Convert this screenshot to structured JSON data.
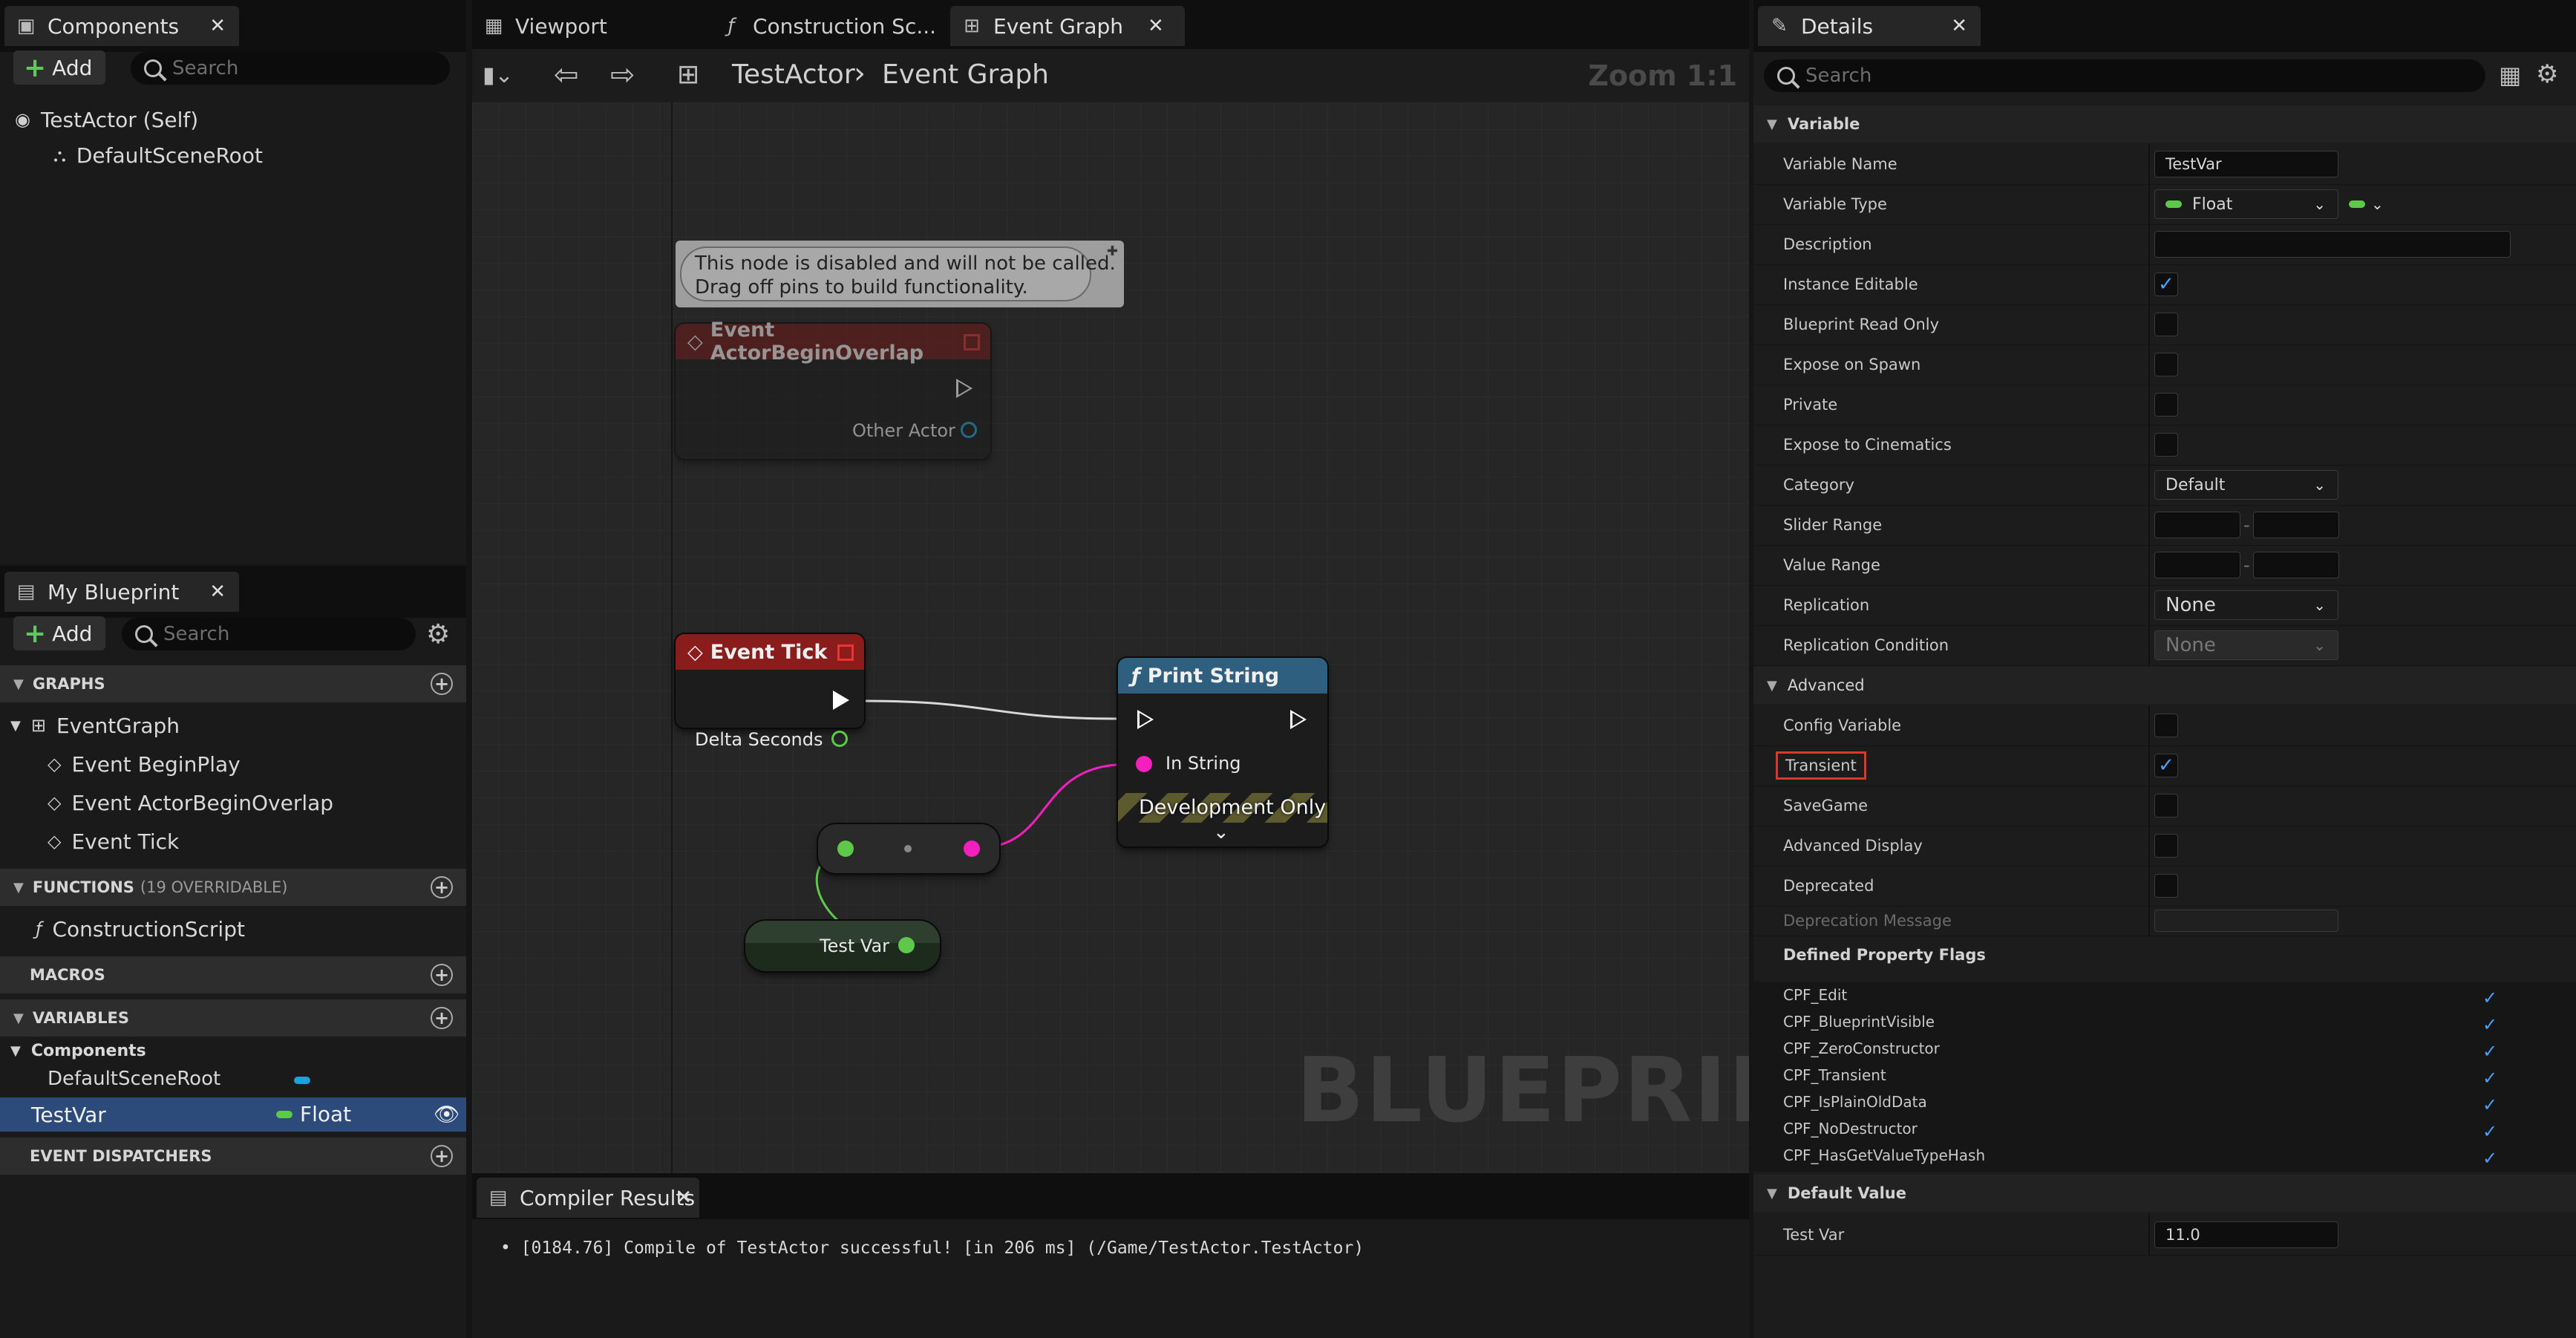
{
  "components_panel": {
    "tab_title": "Components",
    "add_label": "Add",
    "search_placeholder": "Search",
    "tree": [
      "TestActor (Self)",
      "DefaultSceneRoot"
    ]
  },
  "my_blueprint": {
    "tab_title": "My Blueprint",
    "add_label": "Add",
    "search_placeholder": "Search",
    "graphs_label": "GRAPHS",
    "event_graph": "EventGraph",
    "events": [
      "Event BeginPlay",
      "Event ActorBeginOverlap",
      "Event Tick"
    ],
    "functions_label": "FUNCTIONS",
    "functions_count": "(19 OVERRIDABLE)",
    "construction_script": "ConstructionScript",
    "macros_label": "MACROS",
    "variables_label": "VARIABLES",
    "components_group": "Components",
    "default_scene_root": "DefaultSceneRoot",
    "test_var_name": "TestVar",
    "test_var_type": "Float",
    "event_dispatchers_label": "EVENT DISPATCHERS"
  },
  "editor_tabs": [
    "Viewport",
    "Construction Sc...",
    "Event Graph"
  ],
  "breadcrumb": {
    "actor": "TestActor",
    "graph": "Event Graph",
    "zoom": "Zoom 1:1"
  },
  "graph": {
    "comment_line1": "This node is disabled and will not be called.",
    "comment_line2": "Drag off pins to build functionality.",
    "overlap_title": "Event ActorBeginOverlap",
    "other_actor": "Other Actor",
    "tick_title": "Event Tick",
    "delta_seconds": "Delta Seconds",
    "print_title": "Print String",
    "in_string": "In String",
    "dev_only": "Development Only",
    "test_var_node": "Test Var",
    "watermark": "BLUEPRINT"
  },
  "compiler": {
    "tab_title": "Compiler Results",
    "message": "[0184.76] Compile of TestActor successful! [in 206 ms] (/Game/TestActor.TestActor)"
  },
  "details": {
    "tab_title": "Details",
    "search_placeholder": "Search",
    "variable_section": "Variable",
    "rows": {
      "variable_name": "Variable Name",
      "variable_name_value": "TestVar",
      "variable_type": "Variable Type",
      "variable_type_value": "Float",
      "description": "Description",
      "instance_editable": "Instance Editable",
      "blueprint_read_only": "Blueprint Read Only",
      "expose_on_spawn": "Expose on Spawn",
      "private": "Private",
      "expose_to_cinematics": "Expose to Cinematics",
      "category": "Category",
      "category_value": "Default",
      "slider_range": "Slider Range",
      "value_range": "Value Range",
      "replication": "Replication",
      "replication_value": "None",
      "replication_condition": "Replication Condition",
      "replication_condition_value": "None"
    },
    "advanced_section": "Advanced",
    "advanced": {
      "config_variable": "Config Variable",
      "transient": "Transient",
      "savegame": "SaveGame",
      "advanced_display": "Advanced Display",
      "deprecated": "Deprecated",
      "deprecation_message": "Deprecation Message"
    },
    "flags_label": "Defined Property Flags",
    "flags": [
      "CPF_Edit",
      "CPF_BlueprintVisible",
      "CPF_ZeroConstructor",
      "CPF_Transient",
      "CPF_IsPlainOldData",
      "CPF_NoDestructor",
      "CPF_HasGetValueTypeHash"
    ],
    "default_value_section": "Default Value",
    "test_var_label": "Test Var",
    "test_var_value": "11.0"
  },
  "colors": {
    "float_pin": "#5ec84a",
    "string_pin": "#f51fbd",
    "object_pin": "#1fa0d8",
    "event_header": "#8a1c1c",
    "function_header": "#2f5f7f",
    "highlight_red": "#d8392b",
    "selection": "#2c4b7a"
  }
}
